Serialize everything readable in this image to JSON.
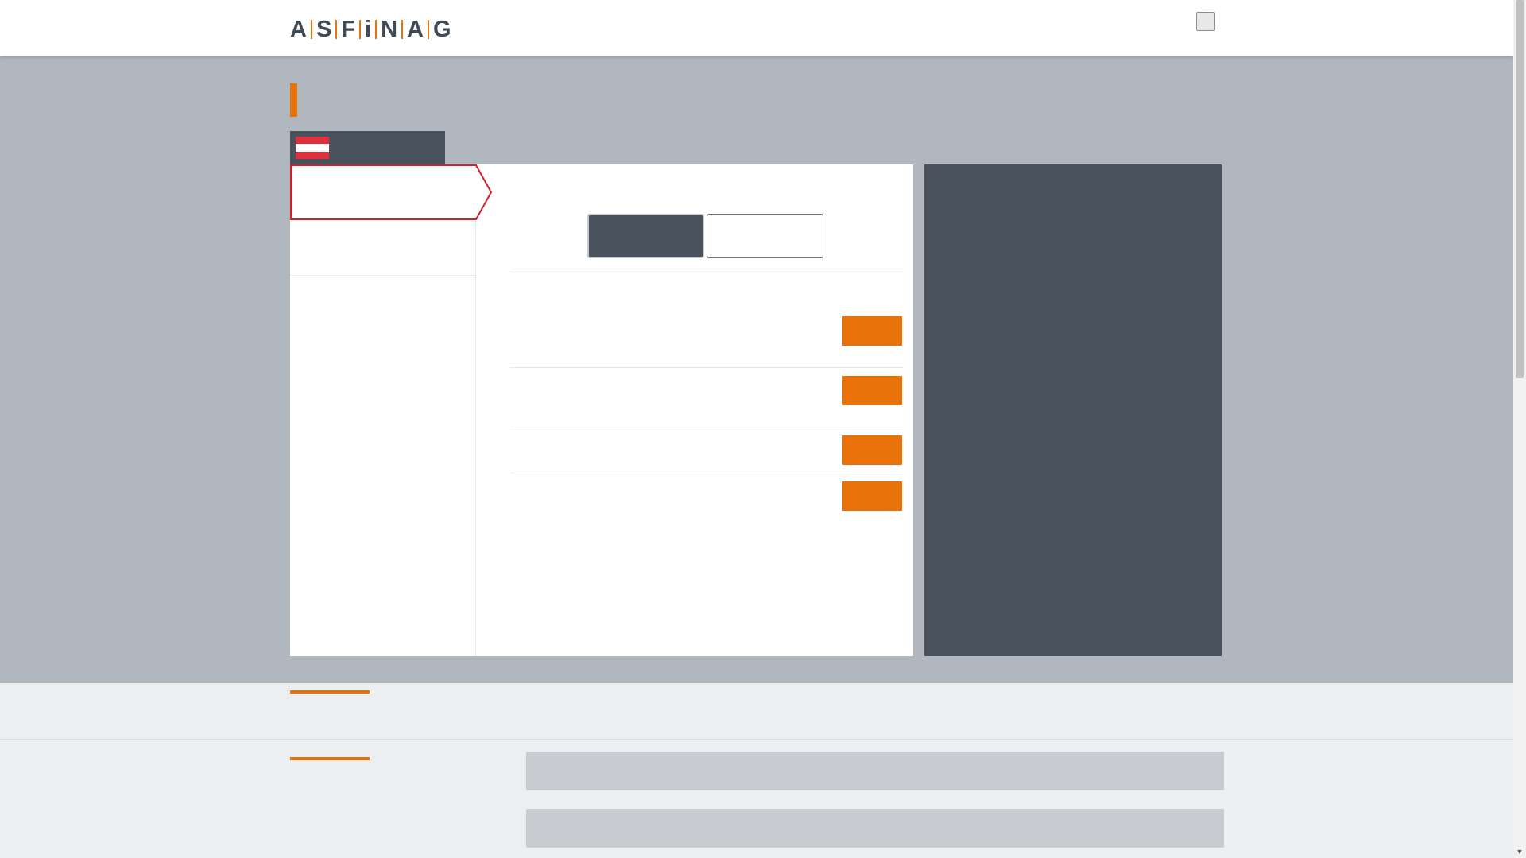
{
  "header": {
    "logo_letters": [
      "A",
      "S",
      "F",
      "i",
      "N",
      "A",
      "G"
    ]
  },
  "hero": {
    "title": "",
    "country_tab": {
      "label": ""
    }
  },
  "main_card": {
    "nav": [
      {
        "label": "",
        "active": true
      },
      {
        "label": ""
      }
    ],
    "toggle": {
      "option_a": "",
      "option_b": ""
    },
    "rows": [
      {
        "label": "",
        "button": ""
      },
      {
        "label": "",
        "button": ""
      },
      {
        "label": "",
        "button": ""
      },
      {
        "label": "",
        "button": ""
      }
    ]
  },
  "info_panel": {
    "text": ""
  },
  "footer": {
    "band_heading": "",
    "section_heading": "",
    "bars": [
      "",
      ""
    ]
  },
  "colors": {
    "accent": "#e8710a",
    "dark_panel": "#4a535d",
    "hero_bg": "#b0b7bf",
    "flag_red": "#e0303d",
    "active_outline": "#d0202a"
  },
  "icons": {
    "flag": "austria-flag-icon",
    "menu": "menu-toggle-icon",
    "scroll": "scroll-down-arrow-icon"
  }
}
